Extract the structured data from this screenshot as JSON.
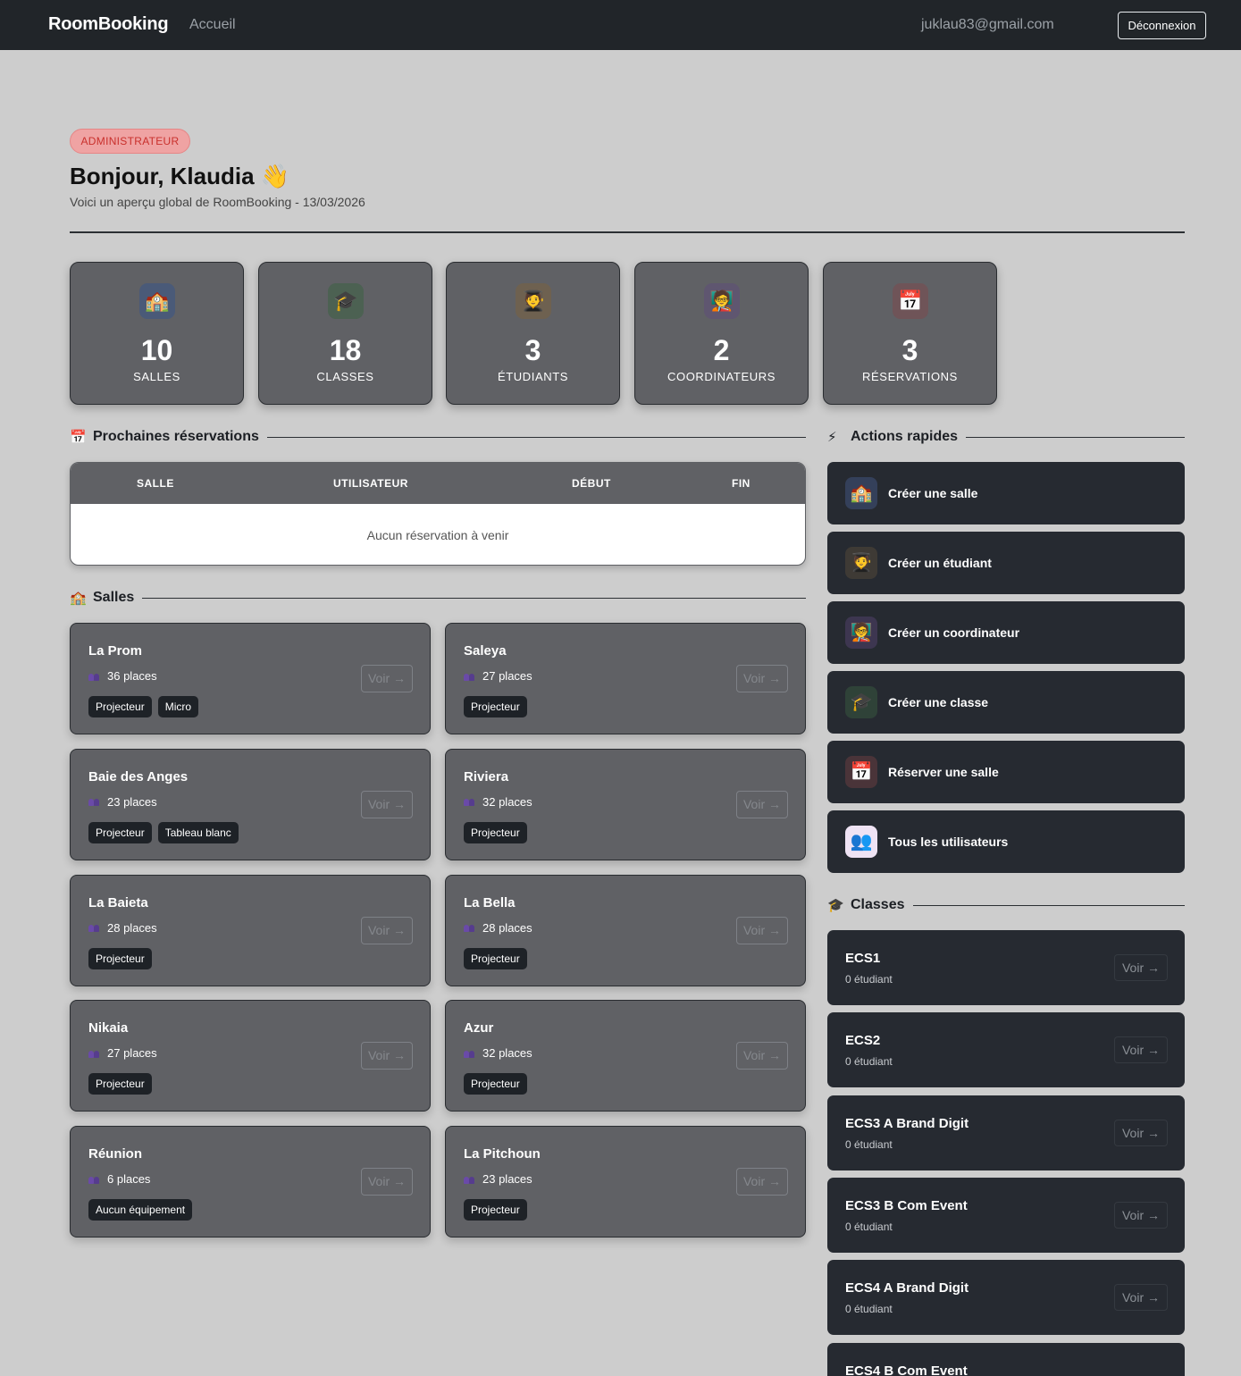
{
  "nav": {
    "brand": "RoomBooking",
    "home_link": "Accueil",
    "user_email": "juklau83@gmail.com",
    "logout_label": "Déconnexion"
  },
  "header": {
    "role_badge": "ADMINISTRATEUR",
    "greeting": "Bonjour, Klaudia 👋",
    "subtitle": "Voici un aperçu global de RoomBooking - 13/03/2026"
  },
  "stats": [
    {
      "icon": "🏫",
      "icon_name": "school-icon",
      "value": "10",
      "label": "SALLES",
      "icon_bg": "#4a5a78"
    },
    {
      "icon": "🎓",
      "icon_name": "graduation-cap-icon",
      "value": "18",
      "label": "CLASSES",
      "icon_bg": "#4c6152"
    },
    {
      "icon": "🧑‍🎓",
      "icon_name": "student-icon",
      "value": "3",
      "label": "ÉTUDIANTS",
      "icon_bg": "#6e6150"
    },
    {
      "icon": "🧑‍🏫",
      "icon_name": "teacher-icon",
      "value": "2",
      "label": "COORDINATEURS",
      "icon_bg": "#5f5670"
    },
    {
      "icon": "📅",
      "icon_name": "calendar-icon",
      "value": "3",
      "label": "RÉSERVATIONS",
      "icon_bg": "#6f5458"
    }
  ],
  "reservations": {
    "icon": "📅",
    "title": "Prochaines réservations",
    "columns": [
      "SALLE",
      "UTILISATEUR",
      "DÉBUT",
      "FIN"
    ],
    "empty_message": "Aucun réservation à venir"
  },
  "rooms": {
    "icon": "🏫",
    "title": "Salles",
    "voir_label": "Voir →",
    "items": [
      {
        "name": "La Prom",
        "places": "36 places",
        "tags": [
          "Projecteur",
          "Micro"
        ]
      },
      {
        "name": "Saleya",
        "places": "27 places",
        "tags": [
          "Projecteur"
        ]
      },
      {
        "name": "Baie des Anges",
        "places": "23 places",
        "tags": [
          "Projecteur",
          "Tableau blanc"
        ]
      },
      {
        "name": "Riviera",
        "places": "32 places",
        "tags": [
          "Projecteur"
        ]
      },
      {
        "name": "La Baieta",
        "places": "28 places",
        "tags": [
          "Projecteur"
        ]
      },
      {
        "name": "La Bella",
        "places": "28 places",
        "tags": [
          "Projecteur"
        ]
      },
      {
        "name": "Nikaia",
        "places": "27 places",
        "tags": [
          "Projecteur"
        ]
      },
      {
        "name": "Azur",
        "places": "32 places",
        "tags": [
          "Projecteur"
        ]
      },
      {
        "name": "Réunion",
        "places": "6 places",
        "tags": [
          "Aucun équipement"
        ]
      },
      {
        "name": "La Pitchoun",
        "places": "23 places",
        "tags": [
          "Projecteur"
        ]
      }
    ]
  },
  "quick_actions": {
    "icon": "⚡",
    "title": "Actions rapides",
    "items": [
      {
        "icon": "🏫",
        "icon_name": "school-icon",
        "label": "Créer une salle",
        "icon_bg": "#34405a"
      },
      {
        "icon": "🧑‍🎓",
        "icon_name": "student-icon",
        "label": "Créer un étudiant",
        "icon_bg": "#3e3a35"
      },
      {
        "icon": "🧑‍🏫",
        "icon_name": "teacher-icon",
        "label": "Créer un coordinateur",
        "icon_bg": "#3d3650"
      },
      {
        "icon": "🎓",
        "icon_name": "graduation-cap-icon",
        "label": "Créer une classe",
        "icon_bg": "#2f4238"
      },
      {
        "icon": "📅",
        "icon_name": "calendar-icon",
        "label": "Réserver une salle",
        "icon_bg": "#4a3439"
      },
      {
        "icon": "👥",
        "icon_name": "users-icon",
        "label": "Tous les utilisateurs",
        "icon_bg": "#efe3f4"
      }
    ]
  },
  "classes": {
    "icon": "🎓",
    "title": "Classes",
    "voir_label": "Voir →",
    "items": [
      {
        "name": "ECS1",
        "count": "0 étudiant"
      },
      {
        "name": "ECS2",
        "count": "0 étudiant"
      },
      {
        "name": "ECS3 A Brand Digit",
        "count": "0 étudiant"
      },
      {
        "name": "ECS3 B Com Event",
        "count": "0 étudiant"
      },
      {
        "name": "ECS4 A Brand Digit",
        "count": "0 étudiant"
      },
      {
        "name": "ECS4 B Com Event",
        "count": ""
      }
    ]
  }
}
